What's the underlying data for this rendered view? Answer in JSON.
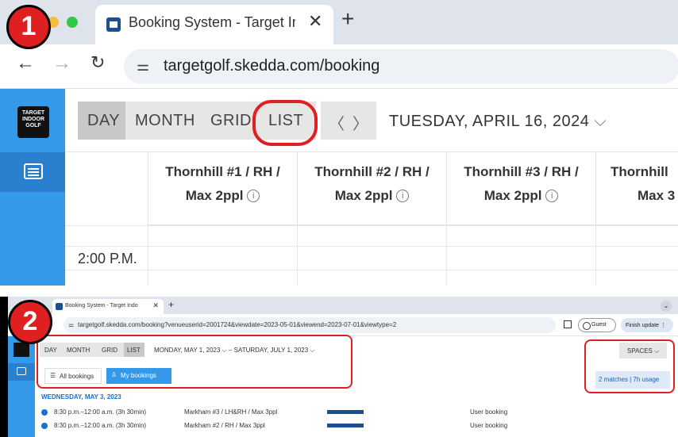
{
  "panel1": {
    "step_number": "1",
    "tab_title": "Booking System - Target Indo",
    "url": "targetgolf.skedda.com/booking",
    "logo_text": "TARGET INDOOR GOLF...",
    "views": [
      "DAY",
      "MONTH",
      "GRID",
      "LIST"
    ],
    "date_title": "TUESDAY, APRIL 16, 2024",
    "columns": [
      {
        "line1": "Thornhill #1 / RH /",
        "line2": "Max 2ppl"
      },
      {
        "line1": "Thornhill #2 / RH /",
        "line2": "Max 2ppl"
      },
      {
        "line1": "Thornhill #3 / RH /",
        "line2": "Max 2ppl"
      },
      {
        "line1": "Thornhill",
        "line2": "Max 3"
      }
    ],
    "time_label": "2:00 P.M."
  },
  "panel2": {
    "step_number": "2",
    "tab_title": "Booking System - Target Indo",
    "url": "targetgolf.skedda.com/booking?venueuserid=2001724&viewdate=2023-05-01&viewend=2023-07-01&viewtype=2",
    "guest_label": "Guest",
    "finish_label": "Finish update",
    "views": [
      "DAY",
      "MONTH",
      "GRID",
      "LIST"
    ],
    "range_start": "MONDAY, MAY 1, 2023",
    "range_sep": "–",
    "range_end": "SATURDAY, JULY 1, 2023",
    "all_bookings": "All bookings",
    "my_bookings": "My bookings",
    "spaces": "SPACES",
    "matches": "2 matches | 7h usage",
    "day_heading": "WEDNESDAY, MAY 3, 2023",
    "rows": [
      {
        "time": "8:30 p.m.–12:00 a.m. (3h 30min)",
        "space": "Markham #3 / LH&RH / Max 3ppl",
        "type": "User booking"
      },
      {
        "time": "8:30 p.m.–12:00 a.m. (3h 30min)",
        "space": "Markham #2 / RH / Max 3ppl",
        "type": "User booking"
      }
    ]
  },
  "colors": {
    "accent": "#3399e8",
    "highlight": "#e02020",
    "link": "#1b6fd1"
  }
}
